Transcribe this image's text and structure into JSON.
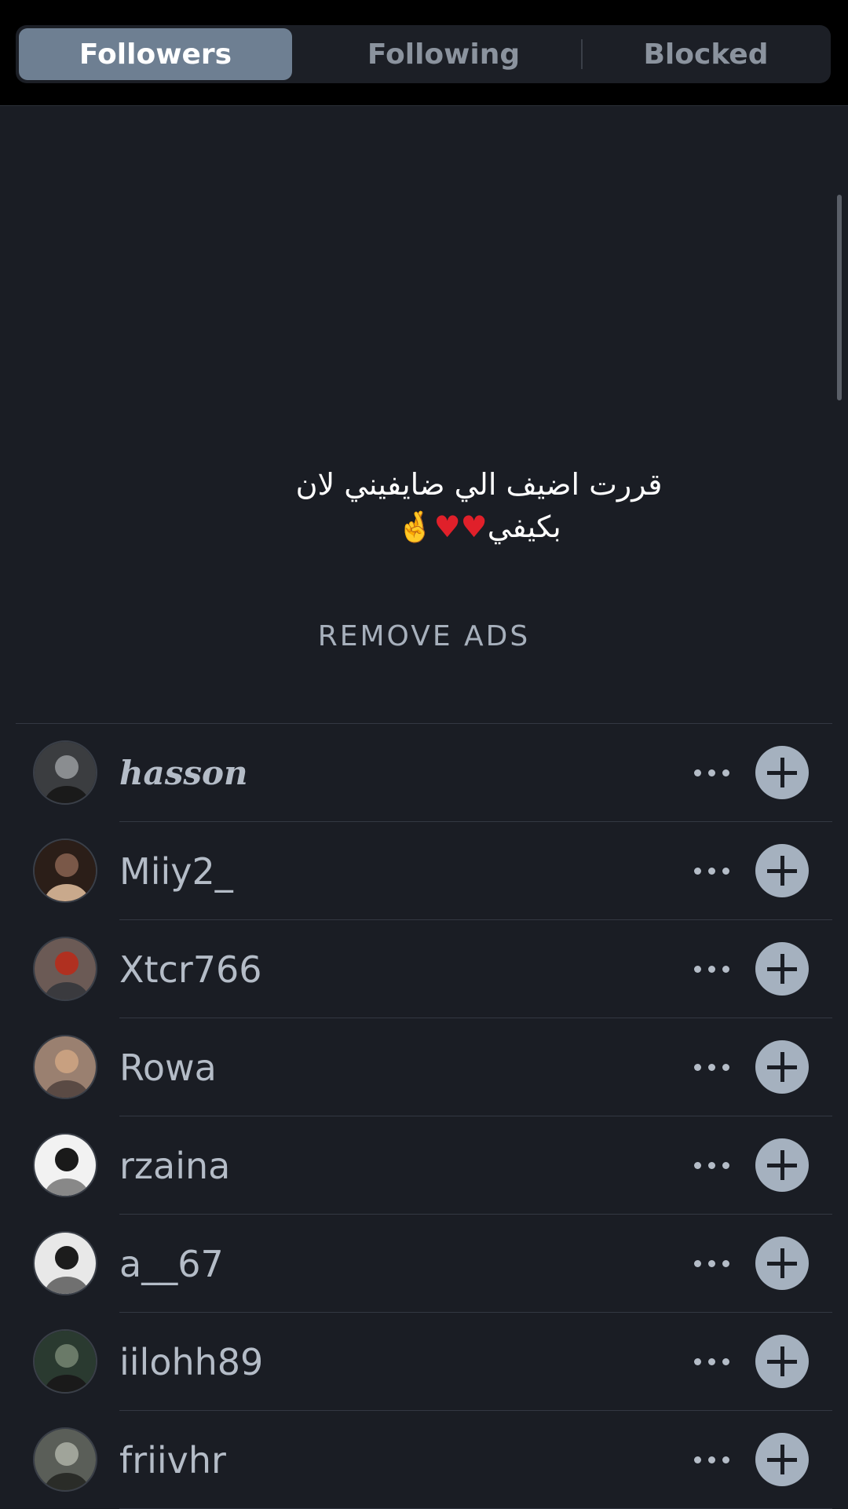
{
  "tabs": [
    {
      "label": "Followers",
      "active": true
    },
    {
      "label": "Following",
      "active": false
    },
    {
      "label": "Blocked",
      "active": false
    }
  ],
  "ad": {
    "line1": "قررت اضيف الي ضايفيني لان",
    "line2": "بكيفي",
    "emoji": "♥♥🤞"
  },
  "remove_ads_label": "REMOVE ADS",
  "followers": [
    {
      "username": "hasson",
      "avatar_icon": "avatar-photo",
      "avatar_colors": [
        "#3b3d40",
        "#8a8d90",
        "#1a1a1a"
      ]
    },
    {
      "username": "Miiy2_",
      "avatar_icon": "avatar-photo",
      "avatar_colors": [
        "#2b1e18",
        "#7a5848",
        "#c9a98c"
      ]
    },
    {
      "username": "Xtcr766",
      "avatar_icon": "avatar-photo",
      "avatar_colors": [
        "#6b5a55",
        "#b03020",
        "#3a3a3e"
      ]
    },
    {
      "username": "Rowa",
      "avatar_icon": "avatar-photo",
      "avatar_colors": [
        "#9a8070",
        "#c8a080",
        "#5a4a44"
      ]
    },
    {
      "username": "rzaina",
      "avatar_icon": "avatar-photo",
      "avatar_colors": [
        "#f2f2f2",
        "#1a1a1a",
        "#888888"
      ]
    },
    {
      "username": "a__67",
      "avatar_icon": "avatar-photo",
      "avatar_colors": [
        "#e8e8e8",
        "#1c1c1c",
        "#707070"
      ]
    },
    {
      "username": "iilohh89",
      "avatar_icon": "avatar-photo",
      "avatar_colors": [
        "#2a3a30",
        "#6a7a68",
        "#1a1a1a"
      ]
    },
    {
      "username": "friivhr",
      "avatar_icon": "avatar-photo",
      "avatar_colors": [
        "#5a5e58",
        "#a0a49a",
        "#2a2c28"
      ]
    }
  ],
  "colors": {
    "background": "#1a1d24",
    "active_tab": "#6e7f92",
    "username_text": "#b4bcc7",
    "add_button": "#a5b1bf"
  }
}
